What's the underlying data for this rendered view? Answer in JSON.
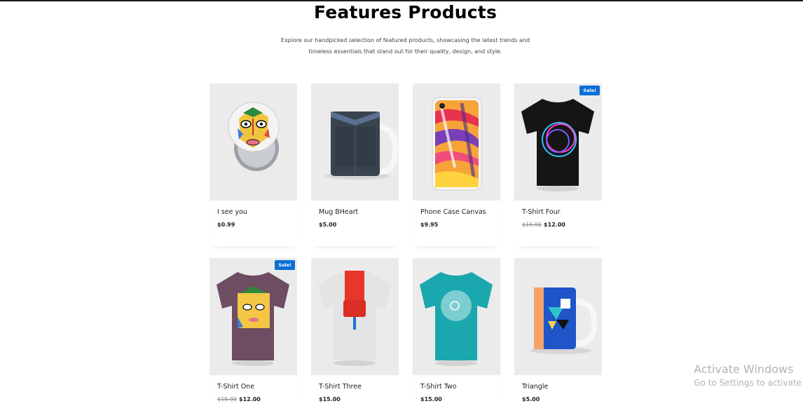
{
  "section": {
    "title": "Features Products",
    "subtitle_line1": "Explore our handpicked selection of featured products, showcasing the latest trends and",
    "subtitle_line2": "timeless essentials that stand out for their quality, design, and style."
  },
  "products": [
    {
      "name": "I see you",
      "price": "$0.99",
      "old_price": "",
      "sale": false,
      "icon": "button-badge-image"
    },
    {
      "name": "Mug BHeart",
      "price": "$5.00",
      "old_price": "",
      "sale": false,
      "icon": "mug-image"
    },
    {
      "name": "Phone Case Canvas",
      "price": "$9.95",
      "old_price": "",
      "sale": false,
      "icon": "phone-case-image"
    },
    {
      "name": "T-Shirt Four",
      "price": "$12.00",
      "old_price": "$15.00",
      "sale": true,
      "badge": "Sale!",
      "icon": "tshirt-image"
    },
    {
      "name": "T-Shirt One",
      "price": "$12.00",
      "old_price": "$15.00",
      "sale": true,
      "badge": "Sale!",
      "icon": "tshirt-image"
    },
    {
      "name": "T-Shirt Three",
      "price": "$15.00",
      "old_price": "",
      "sale": false,
      "icon": "tshirt-image"
    },
    {
      "name": "T-Shirt Two",
      "price": "$15.00",
      "old_price": "",
      "sale": false,
      "icon": "tshirt-image"
    },
    {
      "name": "Triangle",
      "price": "$5.00",
      "old_price": "",
      "sale": false,
      "icon": "mug-image"
    }
  ],
  "watermark": {
    "line1": "Activate Windows",
    "line2": "Go to Settings to activate"
  },
  "colors": {
    "badge": "#0a6fd6",
    "tile_bg": "#ebebeb",
    "tee_black": "#151515",
    "tee_purple": "#6e4c62",
    "tee_white": "#e4e4e4",
    "tee_teal": "#1aa7ad",
    "mug_dark": "#3a4350",
    "mug_blue": "#1f55c9"
  }
}
